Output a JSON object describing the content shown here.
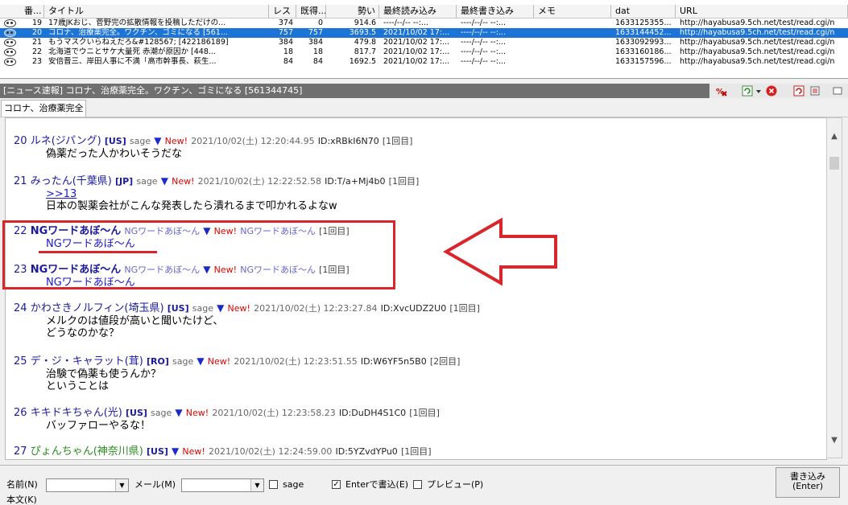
{
  "thread_list": {
    "columns": [
      "番...",
      "タイトル",
      "レス",
      "既得...",
      "勢い",
      "最終読み込み",
      "最終書き込み",
      "メモ",
      "dat",
      "URL"
    ],
    "rows": [
      {
        "num": "19",
        "title": "17歳JKおじ、菅野完の拡散情報を投稿しただけの...",
        "res": "374",
        "got": "0",
        "ikioi": "914.6",
        "last_read": "----/--/-- --:...",
        "last_write": "----/--/-- --:...",
        "memo": "",
        "dat": "1633125355...",
        "url": "http://hayabusa9.5ch.net/test/read.cgi/n",
        "selected": false
      },
      {
        "num": "20",
        "title": "コロナ、治療薬完全。ワクチン、ゴミになる [561...",
        "res": "757",
        "got": "757",
        "ikioi": "3693.5",
        "last_read": "2021/10/02 17:...",
        "last_write": "----/--/-- --:...",
        "memo": "",
        "dat": "1633144452...",
        "url": "http://hayabusa9.5ch.net/test/read.cgi/n",
        "selected": true
      },
      {
        "num": "21",
        "title": "もうマスクいらねえだろ&#128567; [422186189]",
        "res": "384",
        "got": "384",
        "ikioi": "479.8",
        "last_read": "2021/10/02 17:...",
        "last_write": "----/--/-- --:...",
        "memo": "",
        "dat": "1633092993...",
        "url": "http://hayabusa9.5ch.net/test/read.cgi/n",
        "selected": false
      },
      {
        "num": "22",
        "title": "北海道でウニとサケ大量死 赤潮が原因か [448...",
        "res": "18",
        "got": "18",
        "ikioi": "817.7",
        "last_read": "2021/10/02 17:...",
        "last_write": "----/--/-- --:...",
        "memo": "",
        "dat": "1633160186...",
        "url": "http://hayabusa9.5ch.net/test/read.cgi/n",
        "selected": false
      },
      {
        "num": "23",
        "title": "安倍晋三、岸田人事に不満「高市幹事長、萩生...",
        "res": "84",
        "got": "84",
        "ikioi": "1692.5",
        "last_read": "2021/10/02 17:...",
        "last_write": "----/--/-- --:...",
        "memo": "",
        "dat": "1633157596...",
        "url": "http://hayabusa9.5ch.net/test/read.cgi/n",
        "selected": false
      }
    ]
  },
  "thread_title": "[ニュース速報] コロナ、治療薬完全。ワクチン、ゴミになる [561344745]",
  "tab_label": "コロナ、治療薬完全",
  "posts": [
    {
      "num": "20",
      "name": "ルネ(ジパング)",
      "cc": "[US]",
      "mail": "sage",
      "new": "New!",
      "date": "2021/10/02(土) 12:20:44.95",
      "id": "ID:xRBkI6N70",
      "count": "[1回目]",
      "lines": [
        "偽薬だった人かわいそうだな"
      ]
    },
    {
      "num": "21",
      "name": "みったん(千葉県)",
      "cc": "[JP]",
      "mail": "sage",
      "new": "New!",
      "date": "2021/10/02(土) 12:22:52.58",
      "id": "ID:T/a+Mj4b0",
      "count": "[1回目]",
      "lines": [
        ">>13",
        "日本の製薬会社がこんな発表したら潰れるまで叩かれるよなw"
      ]
    },
    {
      "num": "22",
      "name": "NGワードあぼ～ん",
      "ng": "NGワードあぼ～ん",
      "new": "New!",
      "count": "[1回目]",
      "lines": [
        "NGワードあぼ～ん"
      ]
    },
    {
      "num": "23",
      "name": "NGワードあぼ～ん",
      "ng": "NGワードあぼ～ん",
      "new": "New!",
      "count": "[1回目]",
      "lines": [
        "NGワードあぼ～ん"
      ]
    },
    {
      "num": "24",
      "name": "かわさきノルフィン(埼玉県)",
      "cc": "[US]",
      "mail": "sage",
      "new": "New!",
      "date": "2021/10/02(土) 12:23:27.84",
      "id": "ID:XvcUDZ2U0",
      "count": "[1回目]",
      "lines": [
        "メルクのは値段が高いと聞いたけど、",
        "どうなのかな？"
      ]
    },
    {
      "num": "25",
      "name": "デ・ジ・キャラット(茸)",
      "cc": "[RO]",
      "mail": "sage",
      "new": "New!",
      "date": "2021/10/02(土) 12:23:51.55",
      "id": "ID:W6YF5n5B0",
      "count": "[2回目]",
      "lines": [
        "治験で偽薬も使うんか？",
        "ということは"
      ]
    },
    {
      "num": "26",
      "name": "キキドキちゃん(光)",
      "cc": "[US]",
      "mail": "sage",
      "new": "New!",
      "date": "2021/10/02(土) 12:23:58.23",
      "id": "ID:DuDH4S1C0",
      "count": "[1回目]",
      "lines": [
        "バッファローやるな！"
      ]
    },
    {
      "num": "27",
      "name": "ぴょんちゃん(神奈川県)",
      "cc": "[US]",
      "new": "New!",
      "date": "2021/10/02(土) 12:24:59.00",
      "id": "ID:5YZvdYPu0",
      "count": "[1回目]",
      "lines": []
    }
  ],
  "write_bar": {
    "name_label": "名前(N)",
    "mail_label": "メール(M)",
    "sage_label": "sage",
    "enter_label": "Enterで書込(E)",
    "preview_label": "プレビュー(P)",
    "post_button_line1": "書き込み",
    "post_button_line2": "(Enter)",
    "body_label": "本文(K)",
    "enter_checked": true
  },
  "icons": [
    "thread-status-icon",
    "abone-icon",
    "refresh-icon",
    "close-thread-icon",
    "reload-icon",
    "menu-icon"
  ],
  "colors": {
    "selected_row": "#1b74d6",
    "titlebar": "#6f6f6f",
    "annotation_red": "#d9262b",
    "new_red": "#e00000",
    "post_number_blue": "#1a1aa0"
  }
}
